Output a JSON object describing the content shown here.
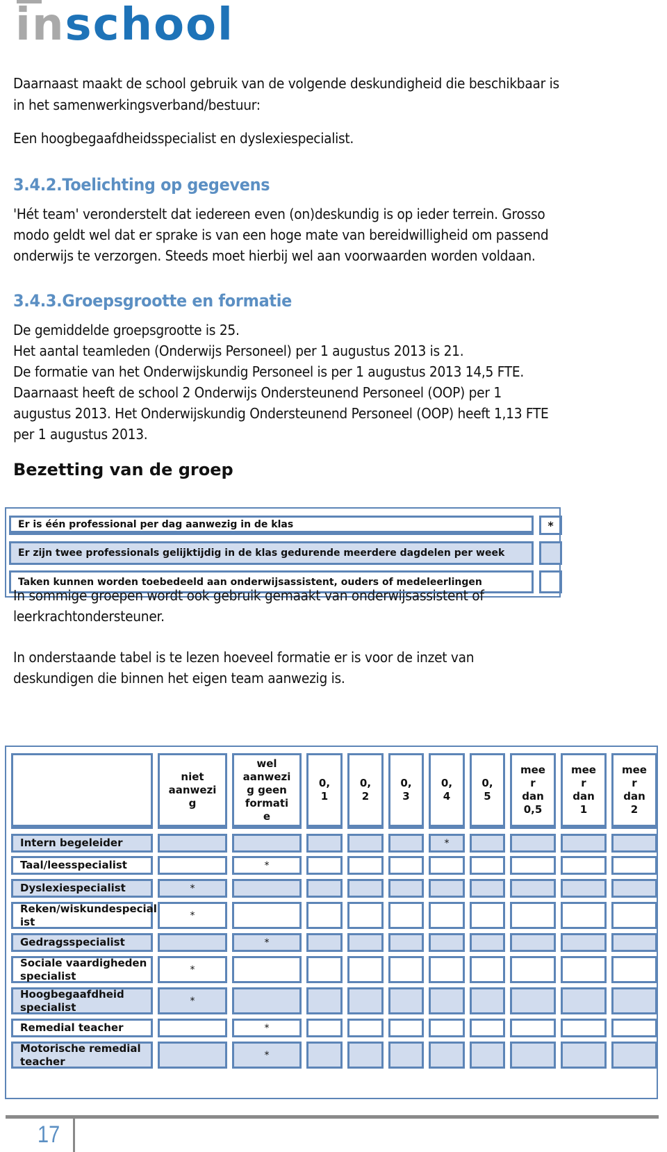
{
  "logo": {
    "part1": "in",
    "part2": "school"
  },
  "paragraphs": {
    "p1_line1": "Daarnaast maakt de school gebruik van de volgende deskundigheid die beschikbaar is",
    "p1_line2": "in het samenwerkingsverband/bestuur:",
    "p2": "Een hoogbegaafdheidsspecialist en dyslexiespecialist."
  },
  "section_342": {
    "heading": "3.4.2.Toelichting op gegevens",
    "lines": [
      "'Hét team' veronderstelt dat iedereen even (on)deskundig is op ieder terrein. Grosso",
      "modo geldt wel dat er sprake is van een hoge mate van bereidwilligheid om passend",
      "onderwijs te verzorgen. Steeds moet hierbij wel aan voorwaarden worden voldaan."
    ]
  },
  "section_343": {
    "heading": "3.4.3.Groepsgrootte en formatie",
    "lines": [
      "De gemiddelde groepsgrootte is 25.",
      "Het aantal teamleden (Onderwijs Personeel) per 1 augustus 2013 is 21.",
      "De formatie van het Onderwijskundig Personeel is per 1 augustus 2013 14,5 FTE.",
      "Daarnaast heeft de school 2 Onderwijs Ondersteunend Personeel (OOP) per 1",
      "augustus 2013. Het Onderwijskundig Ondersteunend Personeel (OOP) heeft 1,13 FTE",
      "per 1 augustus 2013."
    ]
  },
  "bezetting": {
    "heading": "Bezetting van de groep",
    "rows": [
      {
        "label": "Er is één professional per dag aanwezig in de klas",
        "mark": "*"
      },
      {
        "label": "Er zijn twee professionals gelijktijdig in de klas gedurende meerdere dagdelen per week",
        "mark": ""
      },
      {
        "label": "Taken kunnen worden toebedeeld aan onderwijsassistent, ouders of medeleerlingen",
        "mark": ""
      }
    ]
  },
  "after_bezetting": {
    "p1_line1": "In sommige groepen wordt ook gebruik gemaakt van onderwijsassistent of",
    "p1_line2": "leerkrachtondersteuner.",
    "p2_line1": "In onderstaande tabel is te lezen hoeveel formatie er is voor de inzet van",
    "p2_line2": "deskundigen die binnen het eigen team aanwezig is."
  },
  "formatie_table": {
    "columns": [
      "",
      "niet\naanwezi\ng",
      "wel\naanwezi\ng geen\nformati\ne",
      "0,\n1",
      "0,\n2",
      "0,\n3",
      "0,\n4",
      "0,\n5",
      "mee\nr\ndan\n0,5",
      "mee\nr\ndan\n1",
      "mee\nr\ndan\n2"
    ],
    "rows": [
      {
        "label": "Intern begeleider",
        "cells": [
          "",
          "",
          "",
          "",
          "",
          "*",
          "",
          "",
          "",
          ""
        ]
      },
      {
        "label": "Taal/leesspecialist",
        "cells": [
          "",
          "*",
          "",
          "",
          "",
          "",
          "",
          "",
          "",
          ""
        ]
      },
      {
        "label": "Dyslexiespecialist",
        "cells": [
          "*",
          "",
          "",
          "",
          "",
          "",
          "",
          "",
          "",
          ""
        ]
      },
      {
        "label": "Reken/wiskundespecial\nist",
        "cells": [
          "*",
          "",
          "",
          "",
          "",
          "",
          "",
          "",
          "",
          ""
        ]
      },
      {
        "label": "Gedragsspecialist",
        "cells": [
          "",
          "*",
          "",
          "",
          "",
          "",
          "",
          "",
          "",
          ""
        ]
      },
      {
        "label": "Sociale vaardigheden\nspecialist",
        "cells": [
          "*",
          "",
          "",
          "",
          "",
          "",
          "",
          "",
          "",
          ""
        ]
      },
      {
        "label": "Hoogbegaafdheid\nspecialist",
        "cells": [
          "*",
          "",
          "",
          "",
          "",
          "",
          "",
          "",
          "",
          ""
        ]
      },
      {
        "label": "Remedial teacher",
        "cells": [
          "",
          "*",
          "",
          "",
          "",
          "",
          "",
          "",
          "",
          ""
        ]
      },
      {
        "label": "Motorische remedial\nteacher",
        "cells": [
          "",
          "*",
          "",
          "",
          "",
          "",
          "",
          "",
          "",
          ""
        ]
      }
    ]
  },
  "footer": {
    "page_number": "17"
  },
  "colors": {
    "accent": "#5b8fc3",
    "brand_blue": "#1e73b8",
    "table_border": "#5d85b7",
    "table_fill": "#d1dcee"
  }
}
